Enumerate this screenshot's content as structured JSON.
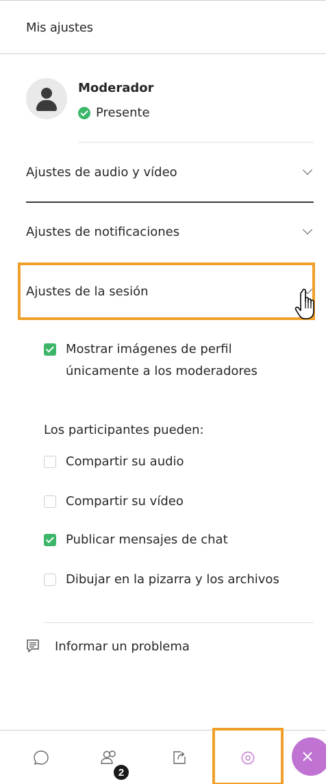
{
  "header": {
    "title": "Mis ajustes"
  },
  "user": {
    "name": "Moderador",
    "status": "Presente"
  },
  "sections": {
    "audio_video": "Ajustes de audio y vídeo",
    "notifications": "Ajustes de notificaciones",
    "session": "Ajustes de la sesión"
  },
  "session_settings": {
    "profile_images": {
      "line1": "Mostrar imágenes de perfil",
      "line2": "únicamente a los moderadores",
      "checked": true
    },
    "participants_heading": "Los participantes pueden:",
    "options": [
      {
        "label": "Compartir su audio",
        "checked": false
      },
      {
        "label": "Compartir su vídeo",
        "checked": false
      },
      {
        "label": "Publicar mensajes de chat",
        "checked": true
      },
      {
        "label": "Dibujar en la pizarra y los archivos",
        "checked": false
      }
    ]
  },
  "report": {
    "label": "Informar un problema"
  },
  "bottom_bar": {
    "tabs": [
      "chat-icon",
      "participants-icon",
      "share-content-icon",
      "settings-icon"
    ],
    "participants_badge": "2",
    "active_tab": "settings-icon"
  },
  "colors": {
    "accent_highlight": "#f0a02a",
    "check_green": "#3db66a",
    "close_purple": "#c073d3"
  }
}
